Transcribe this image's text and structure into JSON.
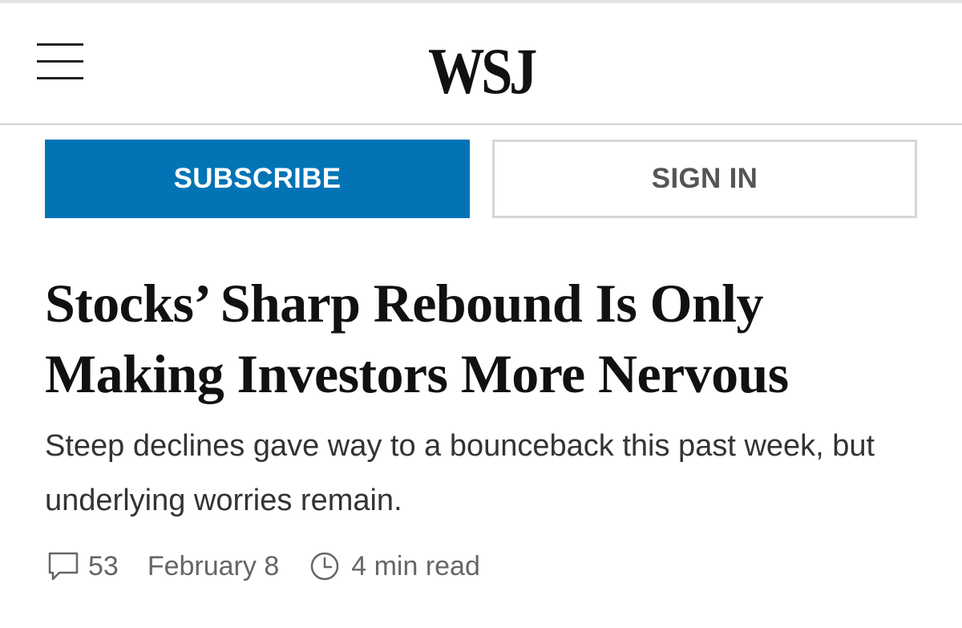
{
  "header": {
    "logo_text": "WSJ",
    "menu_icon": "hamburger-menu-icon"
  },
  "actions": {
    "subscribe_label": "SUBSCRIBE",
    "signin_label": "SIGN IN"
  },
  "article": {
    "headline": "Stocks’ Sharp Rebound Is Only Making Investors More Nervous",
    "dek": "Steep declines gave way to a bounceback this past week, but underlying worries remain.",
    "comment_count": "53",
    "date": "February 8",
    "read_time": "4 min read",
    "comment_icon": "speech-bubble-icon",
    "clock_icon": "clock-icon"
  },
  "colors": {
    "subscribe_bg": "#0274b6",
    "text_primary": "#111111",
    "text_secondary": "#666666"
  }
}
